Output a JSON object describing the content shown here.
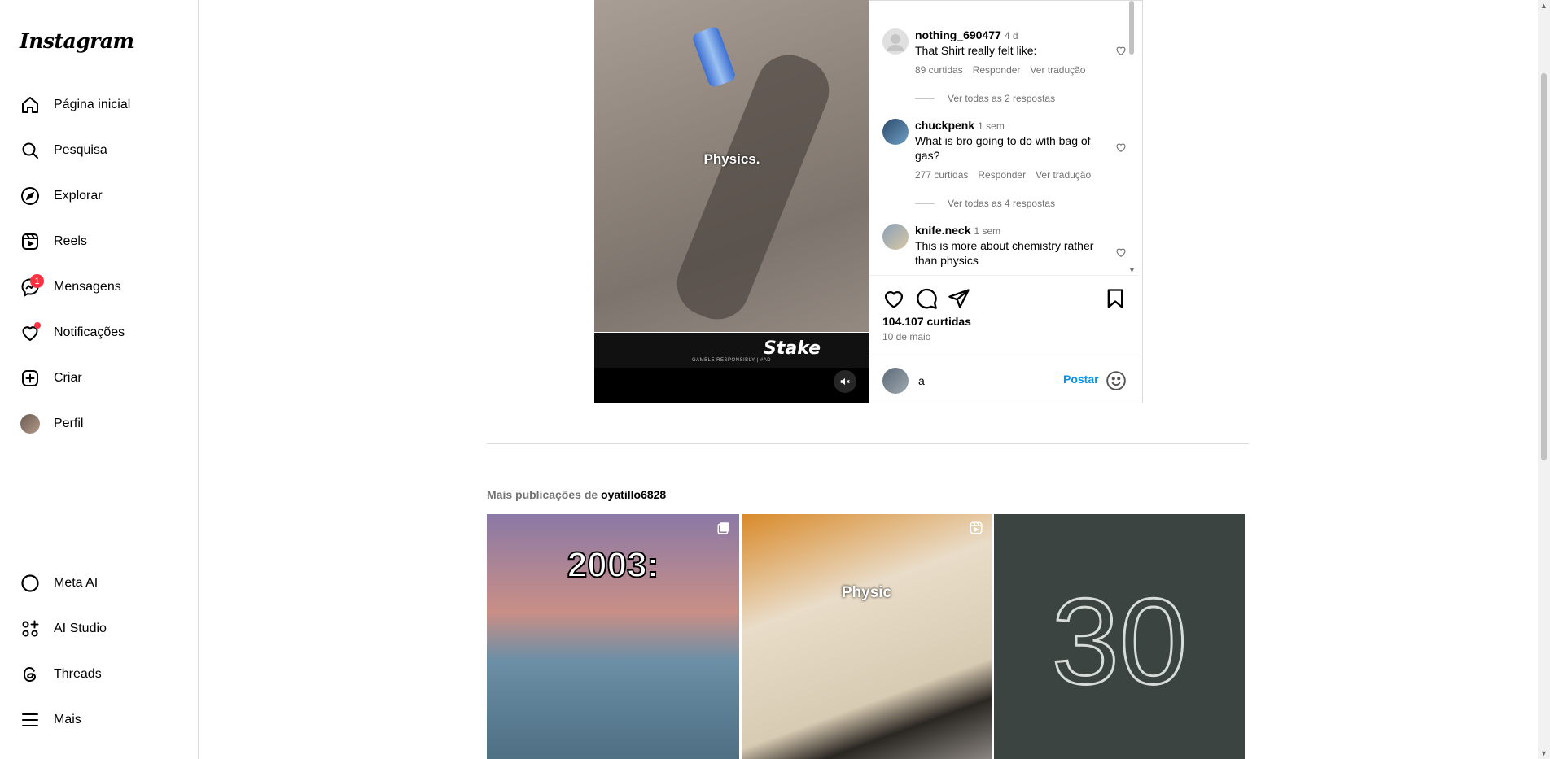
{
  "brand": {
    "logo": "Instagram"
  },
  "sidebar": {
    "items": [
      {
        "label": "Página inicial",
        "icon": "home-icon"
      },
      {
        "label": "Pesquisa",
        "icon": "search-icon"
      },
      {
        "label": "Explorar",
        "icon": "compass-icon"
      },
      {
        "label": "Reels",
        "icon": "reels-icon"
      },
      {
        "label": "Mensagens",
        "icon": "messenger-icon",
        "badge": "1"
      },
      {
        "label": "Notificações",
        "icon": "heart-icon"
      },
      {
        "label": "Criar",
        "icon": "plus-square-icon"
      },
      {
        "label": "Perfil",
        "icon": "avatar"
      }
    ],
    "bottom": [
      {
        "label": "Meta AI",
        "icon": "meta-ai-icon"
      },
      {
        "label": "AI Studio",
        "icon": "ai-studio-icon"
      },
      {
        "label": "Threads",
        "icon": "threads-icon"
      },
      {
        "label": "Mais",
        "icon": "menu-icon"
      }
    ]
  },
  "post": {
    "video_caption": "Physics.",
    "sponsor": "Stake",
    "sponsor_note": "GAMBLE RESPONSIBLY | #AD",
    "comments": [
      {
        "user": "nothing_690477",
        "time": "4 d",
        "text": "That Shirt really felt like:",
        "likes": "89 curtidas",
        "reply": "Responder",
        "translate": "Ver tradução",
        "replies": "Ver todas as 2 respostas"
      },
      {
        "user": "chuckpenk",
        "time": "1 sem",
        "text": "What is bro going to do with bag of gas?",
        "likes": "277 curtidas",
        "reply": "Responder",
        "translate": "Ver tradução",
        "replies": "Ver todas as 4 respostas"
      },
      {
        "user": "knife.neck",
        "time": "1 sem",
        "text": "This is more about chemistry rather than physics"
      }
    ],
    "likes_count": "104.107 curtidas",
    "date": "10 de maio",
    "composer": {
      "value": "a",
      "post_label": "Postar"
    }
  },
  "more": {
    "prefix": "Mais publicações de",
    "owner": "oyatillo6828",
    "tiles": [
      {
        "label": "2003:",
        "icon": "carousel-icon"
      },
      {
        "label": "Physic",
        "icon": "reels-icon"
      },
      {
        "label": "30",
        "icon": ""
      }
    ]
  },
  "colors": {
    "accent": "#0095f6",
    "badge": "#ff3040",
    "muted": "#737373"
  }
}
